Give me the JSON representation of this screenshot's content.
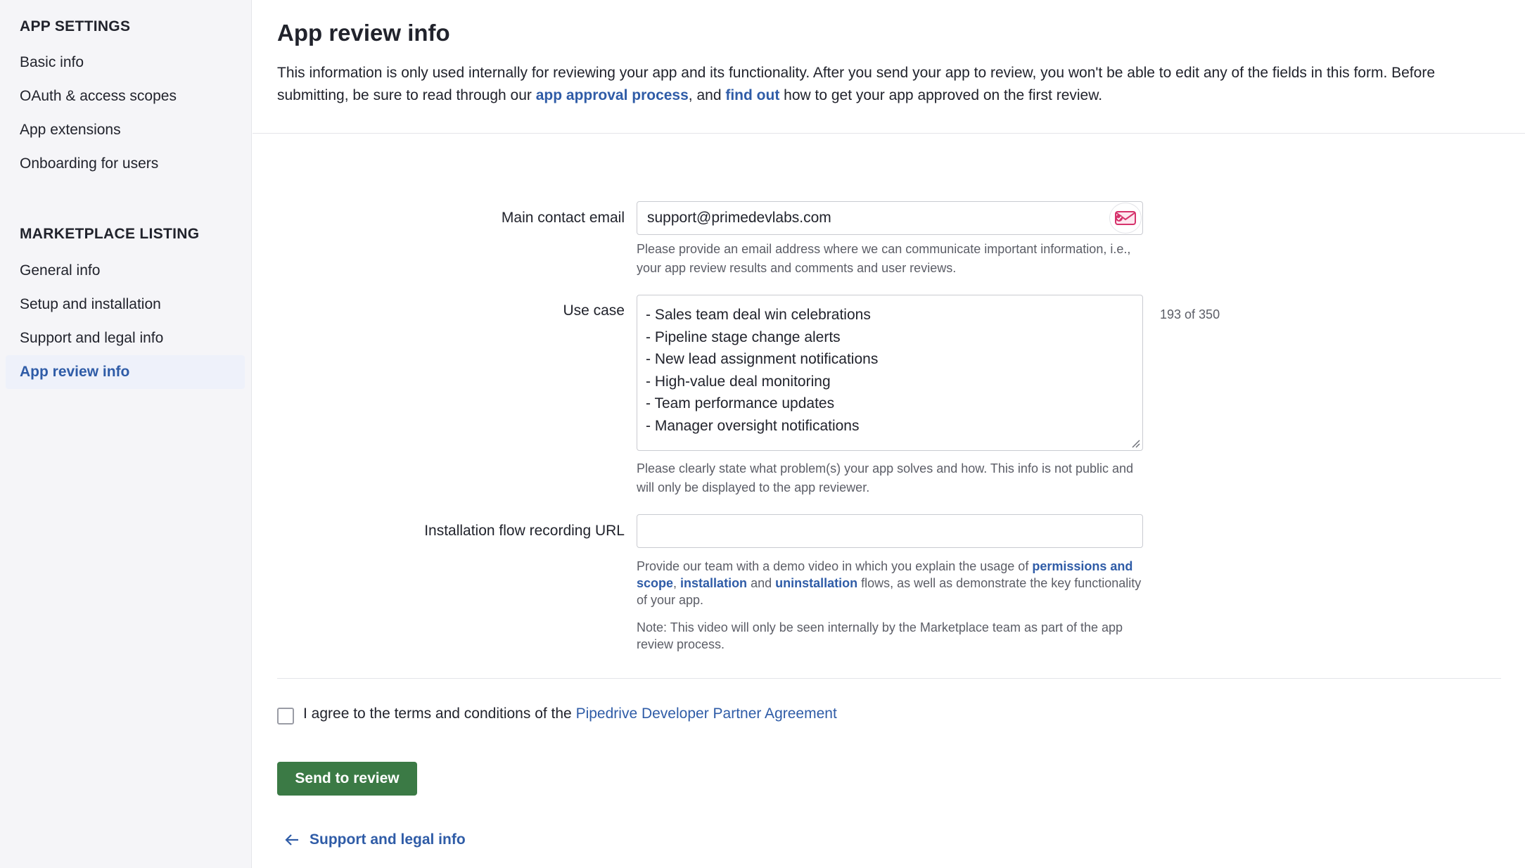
{
  "sidebar": {
    "app_settings_title": "APP SETTINGS",
    "app_settings_items": [
      {
        "label": "Basic info"
      },
      {
        "label": "OAuth & access scopes"
      },
      {
        "label": "App extensions"
      },
      {
        "label": "Onboarding for users"
      }
    ],
    "marketplace_title": "MARKETPLACE LISTING",
    "marketplace_items": [
      {
        "label": "General info"
      },
      {
        "label": "Setup and installation"
      },
      {
        "label": "Support and legal info"
      },
      {
        "label": "App review info",
        "active": true
      }
    ]
  },
  "header": {
    "title": "App review info",
    "intro_part1": "This information is only used internally for reviewing your app and its functionality. After you send your app to review, you won't be able to edit any of the fields in this form. Before submitting, be sure to read through our ",
    "intro_link1": "app approval process",
    "intro_part2": ", and ",
    "intro_link2": "find out",
    "intro_part3": " how to get your app approved on the first review."
  },
  "form": {
    "email": {
      "label": "Main contact email",
      "value": "support@primedevlabs.com",
      "help": "Please provide an email address where we can communicate important information, i.e., your app review results and comments and user reviews."
    },
    "use_case": {
      "label": "Use case",
      "lines": [
        "- Sales team deal win celebrations",
        "- Pipeline stage change alerts",
        "- New lead assignment notifications",
        "- High-value deal monitoring",
        "- Team performance updates",
        "- Manager oversight notifications"
      ],
      "counter": "193 of 350",
      "help": "Please clearly state what problem(s) your app solves and how. This info is not public and will only be displayed to the app reviewer."
    },
    "recording_url": {
      "label": "Installation flow recording URL",
      "value": "",
      "help_part1": "Provide our team with a demo video in which you explain the usage of ",
      "help_link1": "permissions and scope",
      "help_part2": ", ",
      "help_link2": "installation",
      "help_part3": " and ",
      "help_link3": "uninstallation",
      "help_part4": " flows, as well as demonstrate the key functionality of your app.",
      "note": "Note: This video will only be seen internally by the Marketplace team as part of the app review process."
    }
  },
  "agreement": {
    "checked": false,
    "text": "I agree to the terms and conditions of the ",
    "link": "Pipedrive Developer Partner Agreement"
  },
  "actions": {
    "send_label": "Send to review",
    "back_label": "Support and legal info"
  },
  "colors": {
    "link": "#2f5ca7",
    "primary_button": "#3b7a45",
    "sidebar_bg": "#f5f5f8",
    "active_item_bg": "#eef1fa",
    "email_badge": "#d6336c"
  },
  "icons": {
    "email_badge": "email-extension-icon",
    "back": "arrow-left-icon"
  }
}
